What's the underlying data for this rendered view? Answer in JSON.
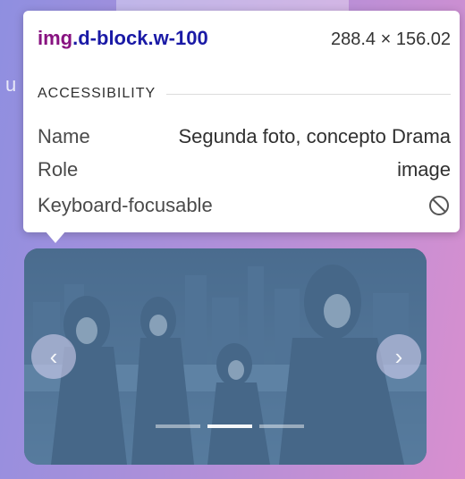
{
  "page": {
    "background_text": "u"
  },
  "tooltip": {
    "selector_tag": "img",
    "selector_classes": ".d-block.w-100",
    "size": "288.4 × 156.02",
    "section_title": "ACCESSIBILITY",
    "rows": [
      {
        "label": "Name",
        "value": "Segunda foto, concepto Drama"
      },
      {
        "label": "Role",
        "value": "image"
      },
      {
        "label": "Keyboard-focusable",
        "value": "",
        "icon": "not-allowed-icon"
      }
    ]
  },
  "carousel": {
    "prev_icon": "chevron-left-icon",
    "next_icon": "chevron-right-icon",
    "indicator_count": 3,
    "active_indicator": 1
  },
  "colors": {
    "highlight_overlay": "#6fa8dc",
    "selector_tag": "#881280",
    "selector_class": "#1a1aa6"
  }
}
